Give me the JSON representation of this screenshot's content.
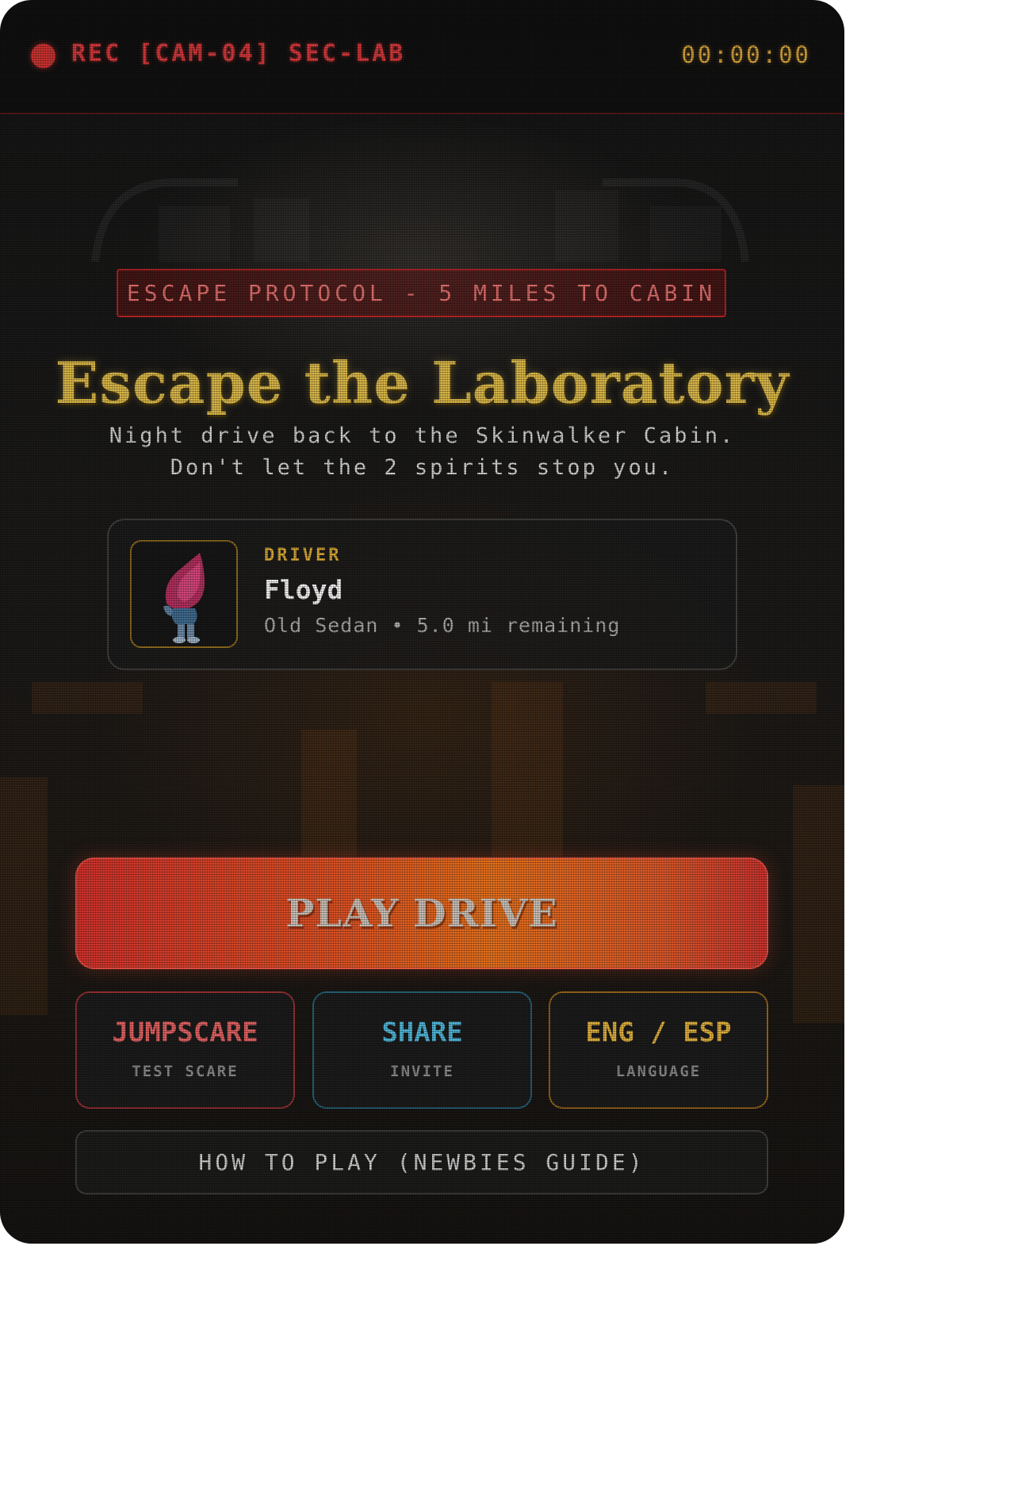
{
  "hud": {
    "rec_label": "REC [CAM-04] SEC-LAB",
    "timecode": "00:00:00",
    "rec_color": "#c8322f"
  },
  "banner": {
    "protocol": "ESCAPE PROTOCOL - 5 MILES TO CABIN"
  },
  "hero": {
    "title": "Escape the Laboratory",
    "subtitle_line1": "Night drive back to the Skinwalker Cabin.",
    "subtitle_line2": "Don't let the 2 spirits stop you."
  },
  "driver": {
    "label": "DRIVER",
    "name": "Floyd",
    "meta": "Old Sedan • 5.0 mi remaining",
    "avatar_icon": "driver-character-icon"
  },
  "actions": {
    "play_label": "PLAY DRIVE",
    "jumpscare_title": "JUMPSCARE",
    "jumpscare_sub": "TEST SCARE",
    "share_title": "SHARE",
    "share_sub": "INVITE",
    "language_title": "ENG / ESP",
    "language_sub": "LANGUAGE",
    "guide_label": "HOW TO PLAY (NEWBIES GUIDE)"
  },
  "colors": {
    "accent_gold": "#d8b648",
    "accent_red": "#d2383a",
    "accent_cyan": "#4fb6d8",
    "play_gradient_start": "#d0322c",
    "play_gradient_mid": "#e4701d"
  }
}
